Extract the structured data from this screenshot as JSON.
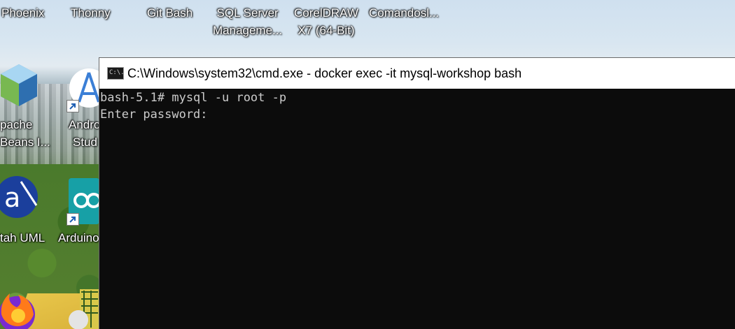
{
  "desktop": {
    "top_icons": [
      {
        "label": "Phoenix"
      },
      {
        "label": "Thonny"
      },
      {
        "label": "Git Bash"
      },
      {
        "label_line1": "SQL Server",
        "label_line2": "Manageme..."
      },
      {
        "label_line1": "CorelDRAW",
        "label_line2": "X7 (64-Bit)"
      },
      {
        "label": "Comandosl..."
      }
    ],
    "left_icons": [
      {
        "label_line1": "pache",
        "label_line2": "Beans I..."
      },
      {
        "label_line1": "Andro",
        "label_line2": "Stud"
      },
      {
        "label": "tah UML"
      },
      {
        "label": "Arduino"
      }
    ]
  },
  "cmd_window": {
    "icon_text": "C:\\.",
    "title": "C:\\Windows\\system32\\cmd.exe - docker  exec -it mysql-workshop bash",
    "lines": [
      "bash-5.1# mysql -u root -p",
      "Enter password:"
    ]
  },
  "colors": {
    "console_bg": "#0c0c0c",
    "console_fg": "#cccccc",
    "titlebar_bg": "#ffffff"
  }
}
